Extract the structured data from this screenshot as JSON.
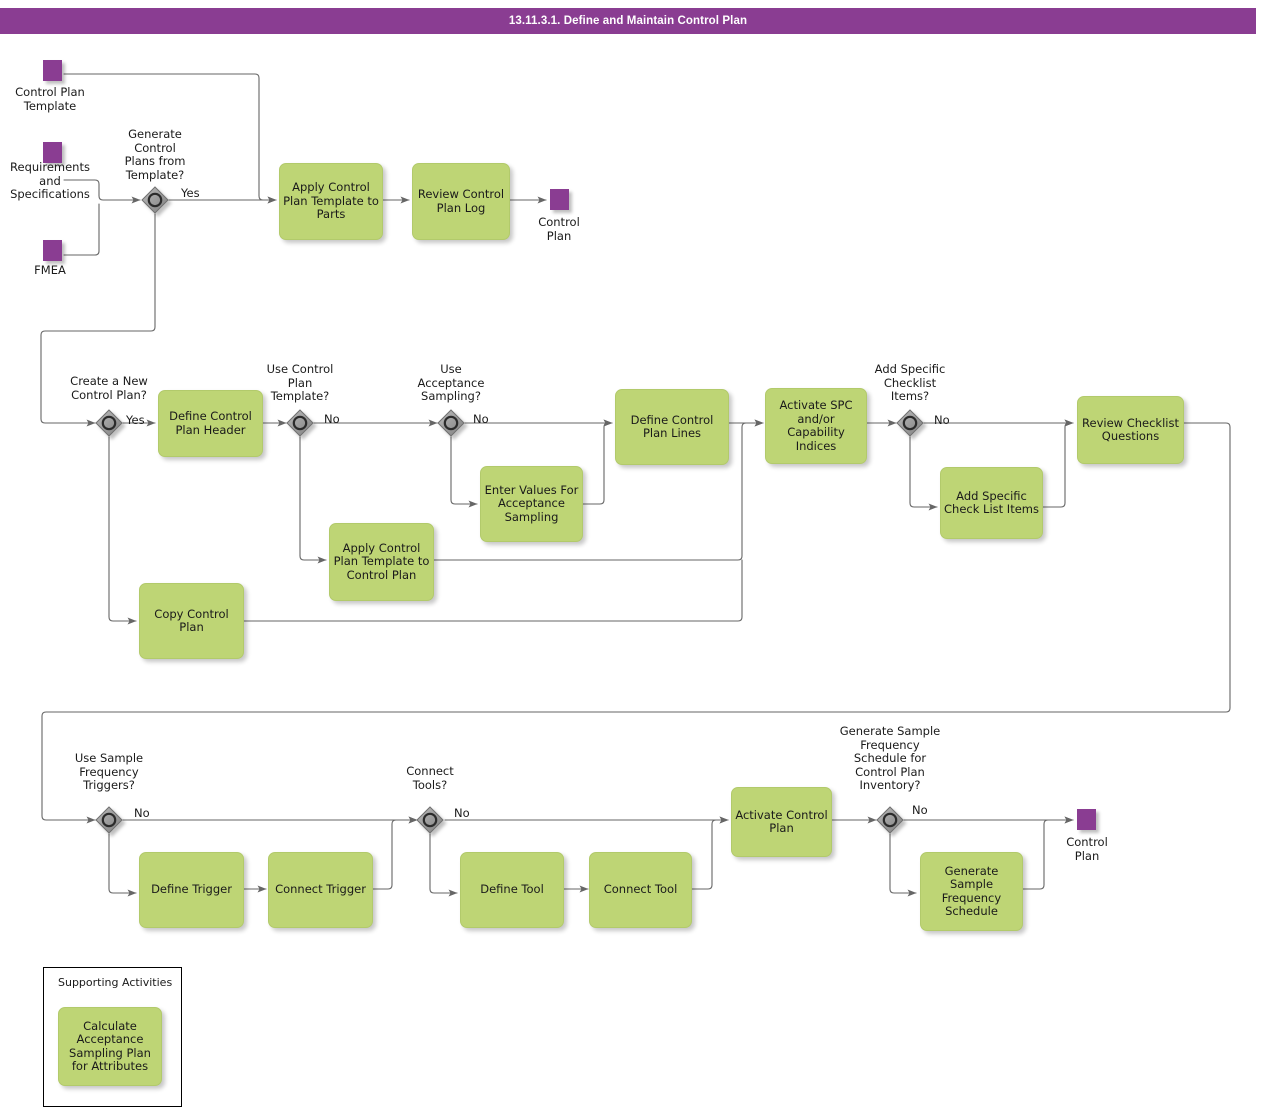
{
  "header": {
    "title": "13.11.3.1. Define and Maintain Control Plan",
    "bar_color": "#8A3D92"
  },
  "theme": {
    "task_fill": "#BED575",
    "data_fill": "#8A3D92",
    "gateway_fill": "#9E9E9E",
    "connector": "#666666",
    "text": "#1a1a1a"
  },
  "data_objects": [
    {
      "id": "do-control-plan-template",
      "label": "Control Plan\nTemplate"
    },
    {
      "id": "do-requirements",
      "label": "Requirements\nand\nSpecifications"
    },
    {
      "id": "do-fmea",
      "label": "FMEA"
    },
    {
      "id": "do-control-plan-top",
      "label": "Control\nPlan"
    },
    {
      "id": "do-control-plan-bottom",
      "label": "Control\nPlan"
    }
  ],
  "gateways": [
    {
      "id": "gw-generate-from-template",
      "label": "Generate\nControl\nPlans from\nTemplate?",
      "branch": "Yes"
    },
    {
      "id": "gw-create-new-control-plan",
      "label": "Create a New\nControl Plan?",
      "branch": "Yes"
    },
    {
      "id": "gw-use-control-plan-template",
      "label": "Use Control\nPlan\nTemplate?",
      "branch": "No"
    },
    {
      "id": "gw-use-acceptance-sampling",
      "label": "Use\nAcceptance\nSampling?",
      "branch": "No"
    },
    {
      "id": "gw-add-specific-checklist-items",
      "label": "Add Specific\nChecklist\nItems?",
      "branch": "No"
    },
    {
      "id": "gw-use-sample-frequency-triggers",
      "label": "Use Sample\nFrequency\nTriggers?",
      "branch": "No"
    },
    {
      "id": "gw-connect-tools",
      "label": "Connect\nTools?",
      "branch": "No"
    },
    {
      "id": "gw-generate-sample-frequency-schedule",
      "label": "Generate Sample\nFrequency\nSchedule for\nControl Plan\nInventory?",
      "branch": "No"
    }
  ],
  "tasks": [
    {
      "id": "task-apply-template-parts",
      "label": "Apply Control\nPlan Template to\nParts"
    },
    {
      "id": "task-review-control-plan-log",
      "label": "Review Control\nPlan Log"
    },
    {
      "id": "task-define-control-plan-header",
      "label": "Define Control\nPlan Header"
    },
    {
      "id": "task-enter-values-acceptance-sampling",
      "label": "Enter Values For\nAcceptance\nSampling"
    },
    {
      "id": "task-apply-template-control-plan",
      "label": "Apply Control\nPlan Template\nto Control Plan"
    },
    {
      "id": "task-copy-control-plan",
      "label": "Copy Control\nPlan"
    },
    {
      "id": "task-define-control-plan-lines",
      "label": "Define Control\nPlan Lines"
    },
    {
      "id": "task-activate-spc",
      "label": "Activate SPC\nand/or\nCapability\nIndices"
    },
    {
      "id": "task-add-specific-check-list-items",
      "label": "Add Specific\nCheck List\nItems"
    },
    {
      "id": "task-review-checklist-questions",
      "label": "Review\nChecklist\nQuestions"
    },
    {
      "id": "task-define-trigger",
      "label": "Define Trigger"
    },
    {
      "id": "task-connect-trigger",
      "label": "Connect Trigger"
    },
    {
      "id": "task-define-tool",
      "label": "Define Tool"
    },
    {
      "id": "task-connect-tool",
      "label": "Connect Tool"
    },
    {
      "id": "task-activate-control-plan",
      "label": "Activate Control\nPlan"
    },
    {
      "id": "task-generate-sample-frequency-schedule",
      "label": "Generate\nSample\nFrequency\nSchedule"
    }
  ],
  "supporting": {
    "title": "Supporting Activities",
    "tasks": [
      {
        "id": "task-calculate-acceptance-sampling-plan",
        "label": "Calculate\nAcceptance\nSampling Plan\nfor Attributes"
      }
    ]
  }
}
